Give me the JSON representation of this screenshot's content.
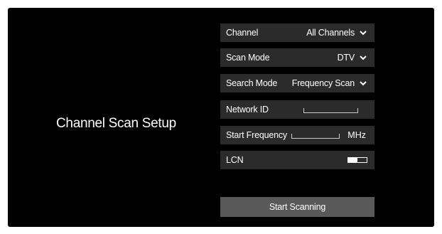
{
  "title": "Channel Scan Setup",
  "settings": {
    "channel": {
      "label": "Channel",
      "value": "All Channels",
      "icon": "chevron-down-icon"
    },
    "scan_mode": {
      "label": "Scan Mode",
      "value": "DTV",
      "icon": "chevron-down-icon"
    },
    "search_mode": {
      "label": "Search Mode",
      "value": "Frequency Scan",
      "icon": "chevron-down-icon"
    },
    "network_id": {
      "label": "Network ID",
      "value": ""
    },
    "start_frequency": {
      "label": "Start Frequency",
      "value": "",
      "unit": "MHz"
    },
    "lcn": {
      "label": "LCN",
      "toggle_state": "on"
    }
  },
  "start_button": {
    "label": "Start Scanning"
  },
  "colors": {
    "background": "#000000",
    "row": "#2b2b2b",
    "button": "#595959",
    "text": "#ffffff"
  }
}
